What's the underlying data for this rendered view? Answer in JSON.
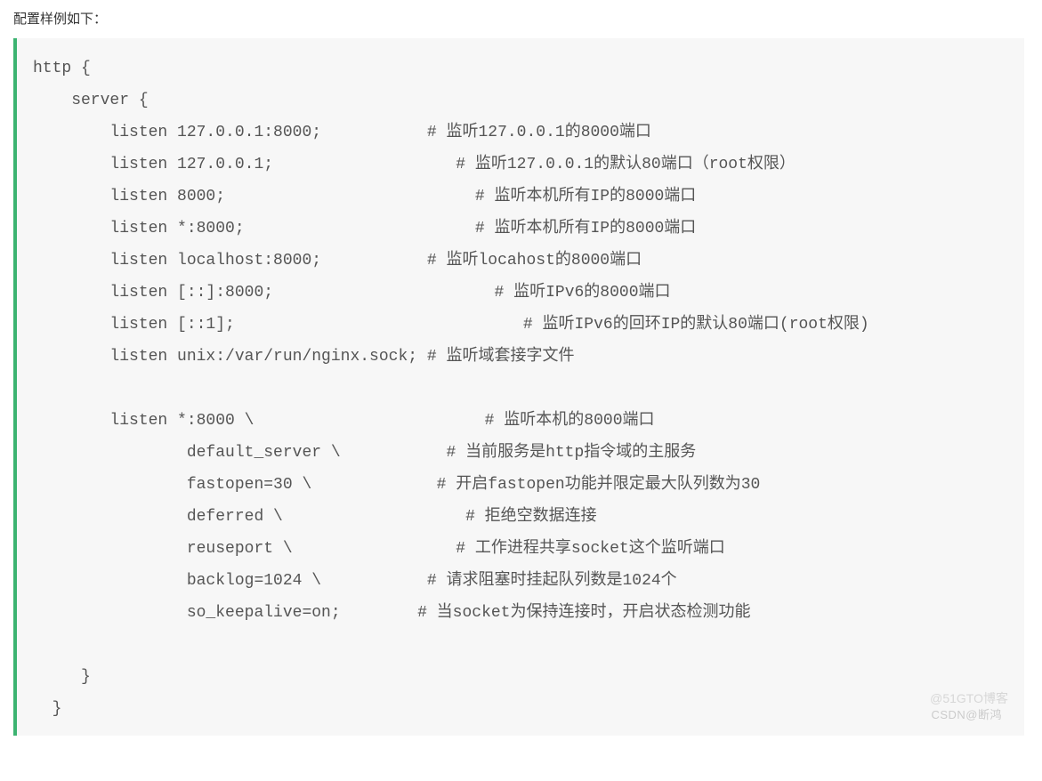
{
  "intro": "配置样例如下：",
  "code": {
    "l01": "http {",
    "l02": "    server {",
    "l03": "        listen 127.0.0.1:8000;           # 监听127.0.0.1的8000端口",
    "l04": "        listen 127.0.0.1;                   # 监听127.0.0.1的默认80端口（root权限）",
    "l05": "        listen 8000;                          # 监听本机所有IP的8000端口",
    "l06": "        listen *:8000;                        # 监听本机所有IP的8000端口",
    "l07": "        listen localhost:8000;           # 监听locahost的8000端口",
    "l08": "        listen [::]:8000;                       # 监听IPv6的8000端口",
    "l09": "        listen [::1];                              # 监听IPv6的回环IP的默认80端口(root权限)",
    "l10": "        listen unix:/var/run/nginx.sock; # 监听域套接字文件",
    "l11": "",
    "l12": "        listen *:8000 \\                        # 监听本机的8000端口",
    "l13": "                default_server \\           # 当前服务是http指令域的主服务",
    "l14": "                fastopen=30 \\             # 开启fastopen功能并限定最大队列数为30",
    "l15": "                deferred \\                   # 拒绝空数据连接",
    "l16": "                reuseport \\                 # 工作进程共享socket这个监听端口",
    "l17": "                backlog=1024 \\           # 请求阻塞时挂起队列数是1024个",
    "l18": "                so_keepalive=on;        # 当socket为保持连接时，开启状态检测功能",
    "l19": "",
    "l20": "     }",
    "l21": "  }"
  },
  "watermark1": "CSDN@断鸿",
  "watermark2": "@51GTO博客"
}
